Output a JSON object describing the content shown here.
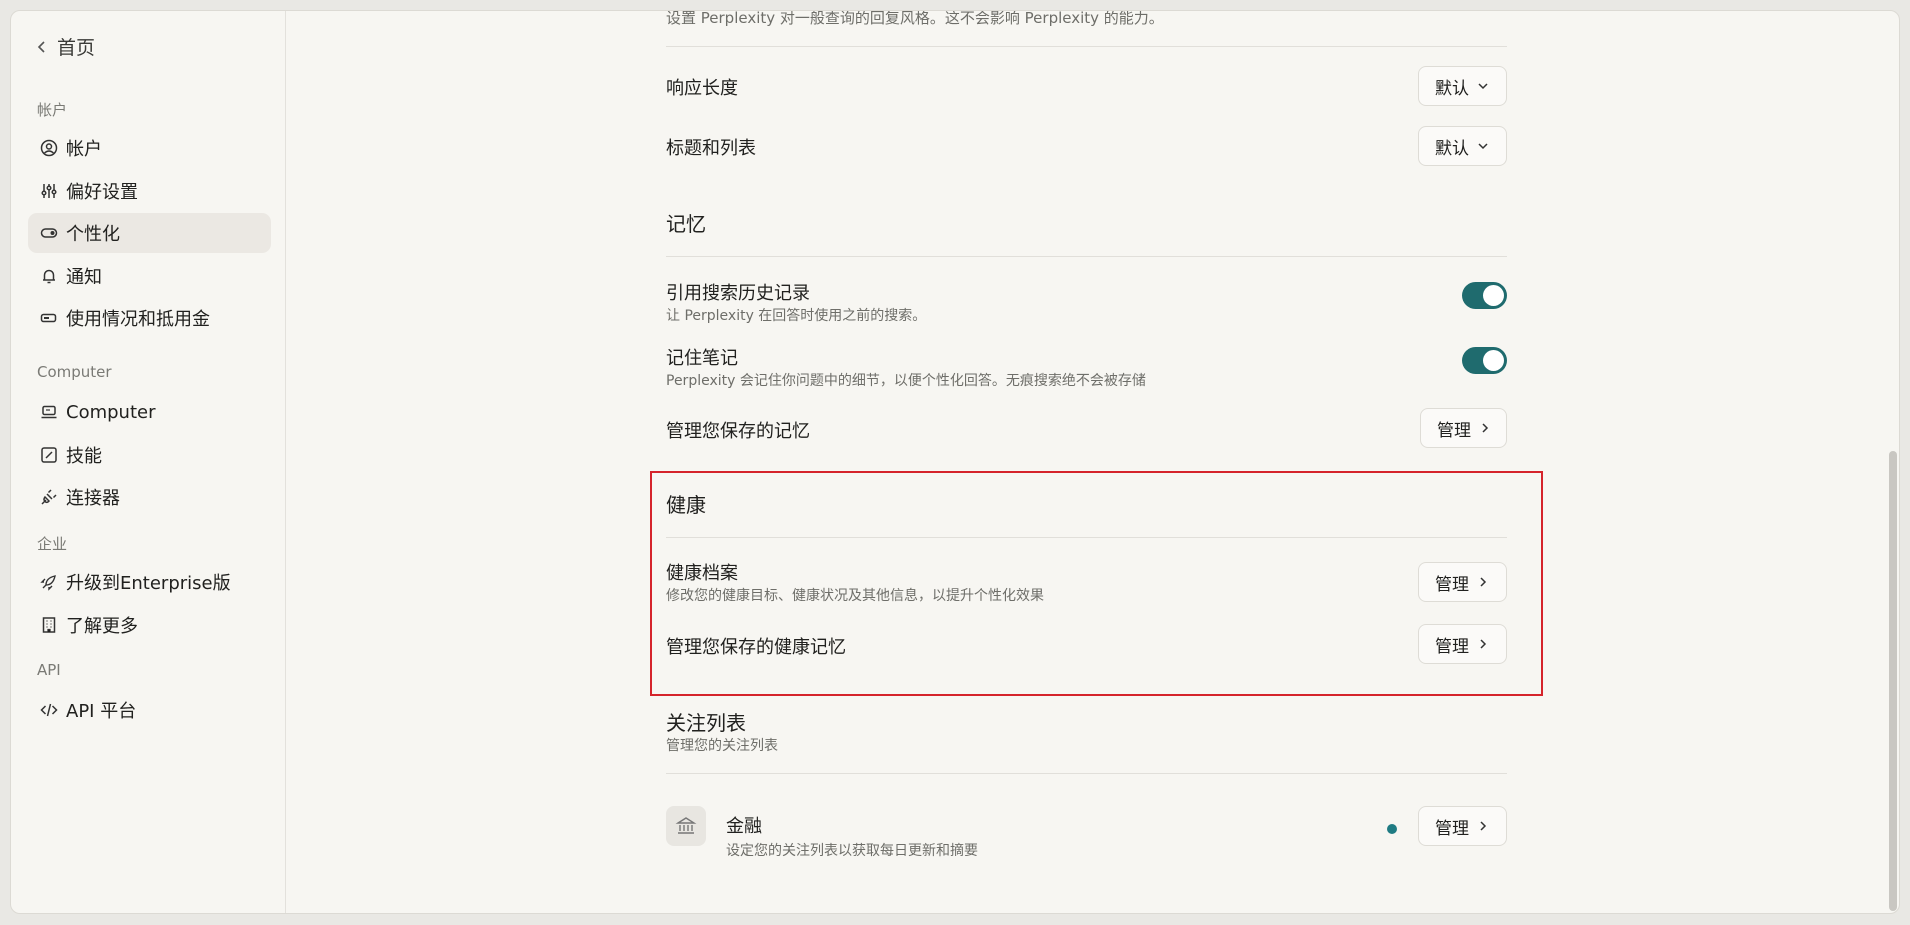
{
  "sidebar": {
    "back_label": "首页",
    "sections": {
      "account": "帐户",
      "computer": "Computer",
      "enterprise": "企业",
      "api": "API"
    },
    "items": [
      {
        "label": "帐户",
        "icon": "user-circle-icon"
      },
      {
        "label": "偏好设置",
        "icon": "sliders-icon"
      },
      {
        "label": "个性化",
        "icon": "toggle-icon",
        "active": true
      },
      {
        "label": "通知",
        "icon": "bell-icon"
      },
      {
        "label": "使用情况和抵用金",
        "icon": "battery-icon"
      },
      {
        "label": "Computer",
        "icon": "laptop-icon"
      },
      {
        "label": "技能",
        "icon": "edit-box-icon"
      },
      {
        "label": "连接器",
        "icon": "plug-icon"
      },
      {
        "label": "升级到Enterprise版",
        "icon": "rocket-icon"
      },
      {
        "label": "了解更多",
        "icon": "building-icon"
      },
      {
        "label": "API 平台",
        "icon": "code-icon"
      }
    ]
  },
  "main": {
    "top_cut_text": "设置 Perplexity 对一般查询的回复风格。这不会影响 Perplexity 的能力。",
    "response_length": {
      "label": "响应长度",
      "value": "默认"
    },
    "headings_lists": {
      "label": "标题和列表",
      "value": "默认"
    },
    "memory": {
      "title": "记忆",
      "reference_history": {
        "label": "引用搜索历史记录",
        "desc": "让 Perplexity 在回答时使用之前的搜索。",
        "enabled": true
      },
      "remember_notes": {
        "label": "记住笔记",
        "desc": "Perplexity 会记住你问题中的细节，以便个性化回答。无痕搜索绝不会被存储",
        "enabled": true
      },
      "manage_saved": {
        "label": "管理您保存的记忆",
        "button": "管理"
      }
    },
    "health": {
      "title": "健康",
      "profile": {
        "label": "健康档案",
        "desc": "修改您的健康目标、健康状况及其他信息，以提升个性化效果",
        "button": "管理"
      },
      "manage_saved": {
        "label": "管理您保存的健康记忆",
        "button": "管理"
      }
    },
    "watchlist": {
      "title": "关注列表",
      "desc": "管理您的关注列表",
      "finance": {
        "label": "金融",
        "desc": "设定您的关注列表以获取每日更新和摘要",
        "button": "管理",
        "icon": "bank-icon"
      }
    }
  },
  "colors": {
    "toggle_on": "#1f6b6e",
    "highlight": "#d5242b",
    "status_dot": "#1f7b83"
  }
}
